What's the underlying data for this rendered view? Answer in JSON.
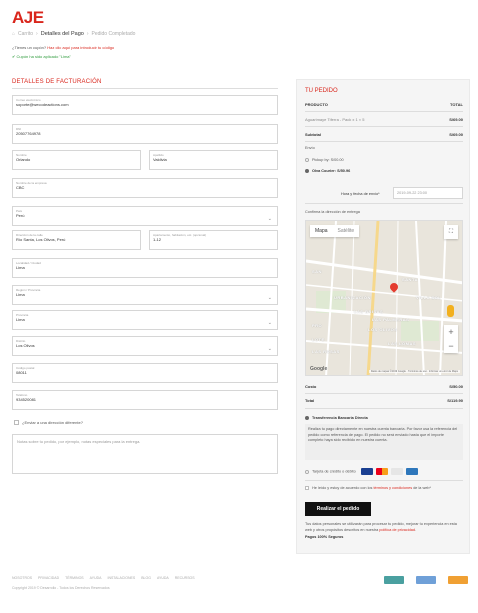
{
  "brand": {
    "logo": "AJE",
    "accent": "#d9261c"
  },
  "breadcrumb": {
    "items": [
      "Carrito",
      "Detalles del Pago",
      "Pedido Completado"
    ],
    "separator": "›"
  },
  "coupon": {
    "prompt": "¿Tienes un cupón?",
    "link": "Haz clic aquí para introducir tu código",
    "applied": "Cupón ha sido aplicado \"Lima\""
  },
  "billing": {
    "title": "DETALLES DE FACTURACIÓN",
    "fields": {
      "email": {
        "label": "Correo electrónico",
        "value": "soporte@wecodeactions.com"
      },
      "dni": {
        "label": "DNI",
        "value": "20507764978"
      },
      "first_name": {
        "label": "Nombre",
        "value": "Orlando"
      },
      "last_name": {
        "label": "Apellido",
        "value": "Valdivia"
      },
      "company": {
        "label": "Nombre de la empresa",
        "value": "CBC"
      },
      "country": {
        "label": "País",
        "value": "Perú"
      },
      "address": {
        "label": "Dirección de la calle",
        "value": "Río Santa, Los Olivos, Perú"
      },
      "address2": {
        "label": "Apartamento, habitación, etc. (opcional)",
        "value": "1-12"
      },
      "city": {
        "label": "Localidad / Ciudad",
        "value": "Lima"
      },
      "region": {
        "label": "Región / Provincia",
        "value": "Lima"
      },
      "province": {
        "label": "Provincia",
        "value": "Lima"
      },
      "district": {
        "label": "Distrito",
        "value": "Los Olivos"
      },
      "postcode": {
        "label": "Código postal",
        "value": "08011"
      },
      "phone": {
        "label": "Teléfono",
        "value": "934520081"
      }
    },
    "ship_different": "¿Enviar a una dirección diferente?",
    "notes_placeholder": "Notas sobre tu pedido, por ejemplo, notas especiales para la entrega."
  },
  "order": {
    "title": "TU PEDIDO",
    "col_product": "PRODUCTO",
    "col_total": "TOTAL",
    "item_name": "Aguarimaye Tiferra - Pack x 1 × 5",
    "item_total": "S/69.00",
    "subtotal_label": "Subtotal",
    "subtotal": "S/69.00",
    "shipping_label": "Envío",
    "ship_pickup": "Pickup by: S/00.00",
    "ship_courier": "Olva Courier: S/50.96",
    "date_label": "Hora y fecha de envío*",
    "date_value": "2019-09-22 23:00",
    "confirm_address": "Confirma la dirección de entrega",
    "map": {
      "tab_map": "Mapa",
      "tab_sat": "Satélite",
      "google": "Google",
      "attribution": "Datos de mapas ©2019 Google · Términos de uso · Informar un error de Maps",
      "labels": [
        "SANTA",
        "URBANIZACIÓN",
        "VILLA SOL",
        "LAS PALMERAS",
        "PRO",
        "LOS OLIVOS",
        "LAS LOMAS",
        "LAS BRISAS",
        "SAN",
        "LOTE",
        "LAS ROSAS"
      ]
    },
    "costo_label": "Costo",
    "costo": "S/50.00",
    "total_label": "Total",
    "total": "S/119.90",
    "pay_bank": "Transferencia Bancaria Directa",
    "pay_bank_desc": "Realiza tu pago directamente en nuestra cuenta bancaria. Por favor usa la referencia del pedido como referencia de pago. El pedido no será enviado hasta que el importe completo haya sido recibido en nuestra cuenta.",
    "pay_card": "Tarjeta de crédito o débito",
    "terms_pre": "He leído y estoy de acuerdo con los",
    "terms_link": "términos y condiciones",
    "terms_post": "de la web",
    "place_order": "Realizar el pedido",
    "privacy_text": "Tus datos personales se utilizarán para procesar tu pedido, mejorar tu experiencia en esta web y otros propósitos descritos en nuestra",
    "privacy_link": "política de privacidad",
    "secure": "Pagos 100% Seguros"
  },
  "footer": {
    "links": [
      "NOSOTROS",
      "PRIVACIDAD",
      "TÉRMINOS",
      "AYUDA",
      "INSTALACIONES",
      "BLOG",
      "AYUDA",
      "RECURSOS"
    ],
    "copyright": "Copyright 2019 © Desarrollo - Todos los Derechos Reservados"
  }
}
